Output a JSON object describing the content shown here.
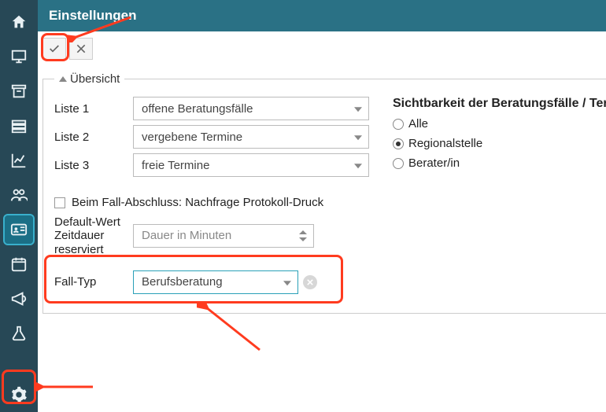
{
  "header": {
    "title": "Einstellungen"
  },
  "toolbar": {
    "confirm_label": "Bestätigen",
    "cancel_label": "Abbrechen"
  },
  "panel": {
    "legend": "Übersicht",
    "lists": {
      "label1": "Liste 1",
      "value1": "offene Beratungsfälle",
      "label2": "Liste 2",
      "value2": "vergebene Termine",
      "label3": "Liste 3",
      "value3": "freie Termine"
    },
    "visibility": {
      "heading": "Sichtbarkeit der Beratungsfälle / Termine",
      "options": {
        "all": "Alle",
        "regional": "Regionalstelle",
        "berater": "Berater/in"
      },
      "selected": "regional"
    },
    "checkbox_label": "Beim Fall-Abschluss: Nachfrage Protokoll-Druck",
    "default_duration": {
      "label": "Default-Wert Zeitdauer reserviert",
      "placeholder": "Dauer in Minuten"
    },
    "falltyp": {
      "label": "Fall-Typ",
      "value": "Berufsberatung"
    }
  },
  "nav": {
    "home": "Startseite",
    "monitor": "Dashboard",
    "archive": "Archiv",
    "inbox": "Ablage",
    "chart": "Statistik",
    "people": "Personen",
    "idcard": "Beratungsfälle",
    "calendar": "Kalender",
    "megaphone": "Mitteilungen",
    "flask": "Labor",
    "settings": "Einstellungen"
  }
}
